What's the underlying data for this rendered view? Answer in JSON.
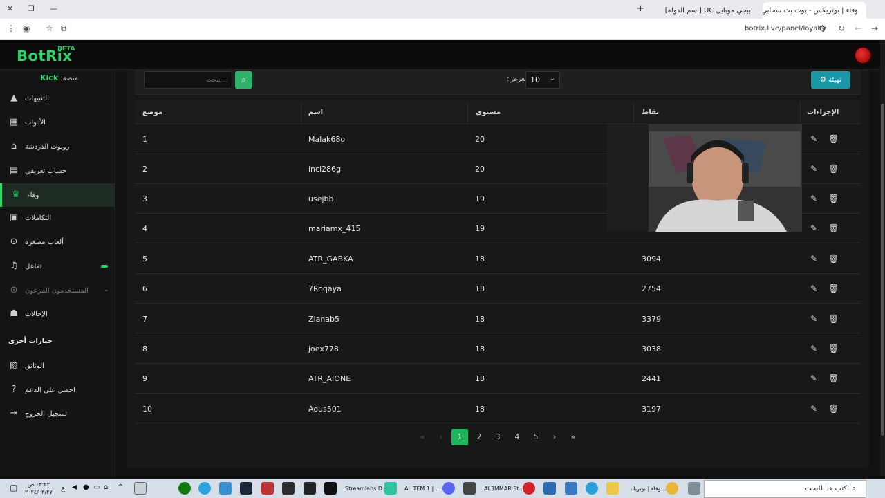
{
  "browser": {
    "tabs": [
      {
        "title": "وفاء | بوتريكس - بوت بث سحابي",
        "active": true
      },
      {
        "title": "ببجي موبايل UC [اسم الدولة] | خ",
        "active": false
      }
    ],
    "url": "botrix.live/panel/loyalty"
  },
  "header": {
    "logo": "BotRix",
    "badge": "BETA"
  },
  "sidebar": {
    "platform_label": "منصة:",
    "platform_value": "Kick",
    "items": [
      {
        "label": "التنبيهات",
        "icon": "warning-icon"
      },
      {
        "label": "الأدوات",
        "icon": "widgets-icon"
      },
      {
        "label": "روبوت الدردشة",
        "icon": "robot-icon"
      },
      {
        "label": "حساب تعريفي",
        "icon": "id-card-icon"
      },
      {
        "label": "وفاء",
        "icon": "trophy-icon",
        "active": true
      },
      {
        "label": "التكاملات",
        "icon": "integrations-icon"
      },
      {
        "label": "ألعاب مصغرة",
        "icon": "gamepad-icon"
      },
      {
        "label": "تفاعل",
        "icon": "music-icon"
      },
      {
        "label": "المستخدمون المرعون",
        "icon": "sponsored-users-icon"
      },
      {
        "label": "الإحالات",
        "icon": "users-icon"
      }
    ],
    "section_title": "خيارات أخرى",
    "other_items": [
      {
        "label": "الوثائق",
        "icon": "docs-icon"
      },
      {
        "label": "احصل على الدعم",
        "icon": "help-icon"
      },
      {
        "label": "تسجيل الخروج",
        "icon": "logout-icon"
      }
    ]
  },
  "toolbar": {
    "search_placeholder": "...يبحث",
    "show_label": "يعرض:",
    "show_value": "10",
    "settings_label": "تهيئة"
  },
  "table": {
    "headers": {
      "position": "موضع",
      "name": "اسم",
      "level": "مستوى",
      "points": "نقاط",
      "actions": "الإجراءات"
    },
    "rows": [
      {
        "position": "1",
        "name": "Malak68o",
        "level": "20",
        "points": ""
      },
      {
        "position": "2",
        "name": "inci286g",
        "level": "20",
        "points": ""
      },
      {
        "position": "3",
        "name": "usejbb",
        "level": "19",
        "points": ""
      },
      {
        "position": "4",
        "name": "mariamx_415",
        "level": "19",
        "points": ""
      },
      {
        "position": "5",
        "name": "ATR_GABKA",
        "level": "18",
        "points": "3094"
      },
      {
        "position": "6",
        "name": "7Roqaya",
        "level": "18",
        "points": "2754"
      },
      {
        "position": "7",
        "name": "Zianab5",
        "level": "18",
        "points": "3379"
      },
      {
        "position": "8",
        "name": "joex778",
        "level": "18",
        "points": "3038"
      },
      {
        "position": "9",
        "name": "ATR_AIONE",
        "level": "18",
        "points": "2441"
      },
      {
        "position": "10",
        "name": "Aous501",
        "level": "18",
        "points": "3197"
      }
    ]
  },
  "pagination": {
    "first": "«",
    "prev": "‹",
    "pages": [
      "1",
      "2",
      "3",
      "4",
      "5"
    ],
    "current": "1",
    "next": "›",
    "last": "»"
  },
  "taskbar": {
    "search_placeholder": "اكتب هنا للبحث",
    "apps": [
      {
        "label": "وفاء | بوتريك..."
      },
      {
        "label": "AL3MMAR St..."
      },
      {
        "label": "AL TEM 1 | ..."
      },
      {
        "label": "Streamlabs D..."
      }
    ],
    "time": "٠٣:٢٣ ص",
    "date": "٢٠٢٤/٠٣/٢٧",
    "lang": "ع"
  },
  "colors": {
    "accent": "#2fd36b",
    "settings": "#1a98a6",
    "page_active": "#1fb55a",
    "background": "#121212"
  }
}
